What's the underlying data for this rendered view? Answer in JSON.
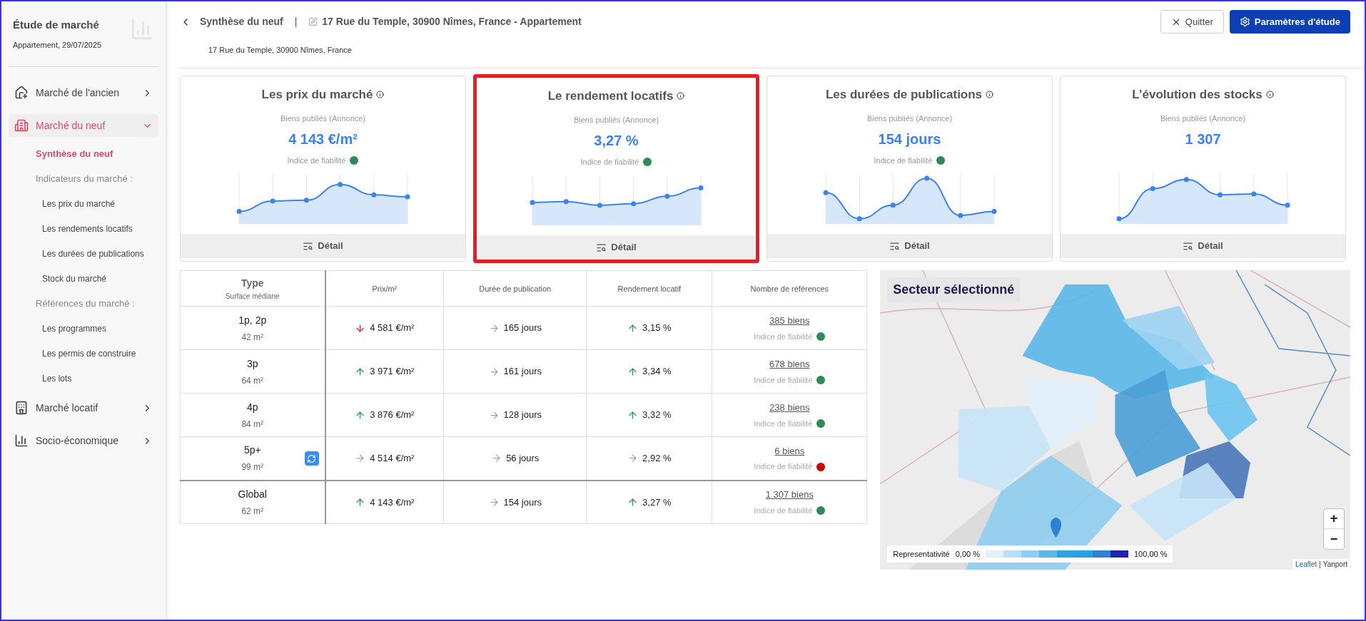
{
  "sidebar": {
    "title": "Étude de marché",
    "subtitle": "Appartement, 29/07/2025",
    "items": [
      {
        "label": "Marché de l'ancien",
        "expanded": false,
        "selected": false
      },
      {
        "label": "Marché du neuf",
        "expanded": true,
        "selected": true,
        "children": [
          {
            "label": "Synthèse du neuf",
            "selected": true
          },
          {
            "label": "Indicateurs du marché :",
            "selected": false,
            "children": [
              {
                "label": "Les prix du marché",
                "selected": false
              },
              {
                "label": "Les rendements locatifs",
                "selected": false
              },
              {
                "label": "Les durées de publications",
                "selected": false
              },
              {
                "label": "Stock du marché",
                "selected": false
              }
            ]
          },
          {
            "label": "Références du marché :",
            "selected": false,
            "children": [
              {
                "label": "Les programmes",
                "selected": false
              },
              {
                "label": "Les permis de construire",
                "selected": false
              },
              {
                "label": "Les lots",
                "selected": false
              }
            ]
          }
        ]
      },
      {
        "label": "Marché locatif",
        "expanded": false,
        "selected": false
      },
      {
        "label": "Socio-économique",
        "expanded": false,
        "selected": false
      }
    ]
  },
  "header": {
    "page": "Synthèse du neuf",
    "separator": "|",
    "title": "17 Rue du Temple, 30900 Nîmes, France - Appartement",
    "address": "17 Rue du Temple, 30900 Nîmes, France",
    "buttons": [
      {
        "label": "Quitter",
        "kind": "secondary"
      },
      {
        "label": "Paramètres d'étude",
        "kind": "primary"
      }
    ]
  },
  "cards": [
    {
      "title": "Les prix du marché",
      "subtitle": "Biens publiés (Annonce)",
      "value": "4 143 €/m²",
      "reliability": {
        "label": "Indice de fiabilité",
        "color": "#2e8b57"
      },
      "button": "Détail",
      "highlighted": false
    },
    {
      "title": "Le rendement locatifs",
      "subtitle": "Biens publiés (Annonce)",
      "value": "3,27 %",
      "reliability": {
        "label": "Indice de fiabilité",
        "color": "#2e8b57"
      },
      "button": "Détail",
      "highlighted": true
    },
    {
      "title": "Les durées de publications",
      "subtitle": "Biens publiés (Annonce)",
      "value": "154 jours",
      "reliability": {
        "label": "Indice de fiabilité",
        "color": "#2e8b57"
      },
      "button": "Détail",
      "highlighted": false
    },
    {
      "title": "L’évolution des stocks",
      "subtitle": "Biens publiés (Annonce)",
      "value": "1 307",
      "button": "Détail",
      "highlighted": false
    }
  ],
  "table": {
    "type_header": "Type",
    "type_subheader": "Surface médiane",
    "columns": [
      "Prix/m²",
      "Durée de publication",
      "Rendement locatif",
      "Nombre de références"
    ],
    "rows": [
      {
        "type": "1p, 2p",
        "surface": "42 m²",
        "refresh": false,
        "kind": "row",
        "cells": [
          {
            "value": "4 581 €/m²",
            "rising": false,
            "falling": true
          },
          {
            "value": "165 jours",
            "rising": false,
            "falling": false
          },
          {
            "value": "3,15 %",
            "rising": true,
            "falling": false
          }
        ],
        "refs": "385 biens",
        "reliability": {
          "label": "Indice de fiabilité",
          "color": "#2e8b57"
        }
      },
      {
        "type": "3p",
        "surface": "64 m²",
        "refresh": false,
        "kind": "row",
        "cells": [
          {
            "value": "3 971 €/m²",
            "rising": true,
            "falling": false
          },
          {
            "value": "161 jours",
            "rising": false,
            "falling": false
          },
          {
            "value": "3,34 %",
            "rising": true,
            "falling": false
          }
        ],
        "refs": "678 biens",
        "reliability": {
          "label": "Indice de fiabilité",
          "color": "#2e8b57"
        }
      },
      {
        "type": "4p",
        "surface": "84 m²",
        "refresh": false,
        "kind": "row",
        "cells": [
          {
            "value": "3 876 €/m²",
            "rising": true,
            "falling": false
          },
          {
            "value": "128 jours",
            "rising": false,
            "falling": false
          },
          {
            "value": "3,32 %",
            "rising": true,
            "falling": false
          }
        ],
        "refs": "238 biens",
        "reliability": {
          "label": "Indice de fiabilité",
          "color": "#2e8b57"
        }
      },
      {
        "type": "5p+",
        "surface": "99 m²",
        "refresh": true,
        "kind": "row",
        "cells": [
          {
            "value": "4 514 €/m²",
            "rising": false,
            "falling": false
          },
          {
            "value": "56 jours",
            "rising": false,
            "falling": false
          },
          {
            "value": "2,92 %",
            "rising": false,
            "falling": false
          }
        ],
        "refs": "6 biens",
        "reliability": {
          "label": "Indice de fiabilité",
          "color": "#cc0000"
        }
      },
      {
        "type": "Global",
        "surface": "62 m²",
        "refresh": false,
        "kind": "total",
        "cells": [
          {
            "value": "4 143 €/m²",
            "rising": true,
            "falling": false
          },
          {
            "value": "154 jours",
            "rising": false,
            "falling": false
          },
          {
            "value": "3,27 %",
            "rising": true,
            "falling": false
          }
        ],
        "refs": "1 307 biens",
        "reliability": {
          "label": "Indice de fiabilité",
          "color": "#2e8b57"
        }
      }
    ]
  },
  "map": {
    "kind": "picture",
    "title": "Secteur sélectionné",
    "legend": {
      "label": "Representativité",
      "min": "0,00 %",
      "max": "100,00 %"
    },
    "zoom": [
      "+",
      "−"
    ],
    "attribution": {
      "link": "Leaflet",
      "separator": "|",
      "source": "Yanport"
    }
  }
}
